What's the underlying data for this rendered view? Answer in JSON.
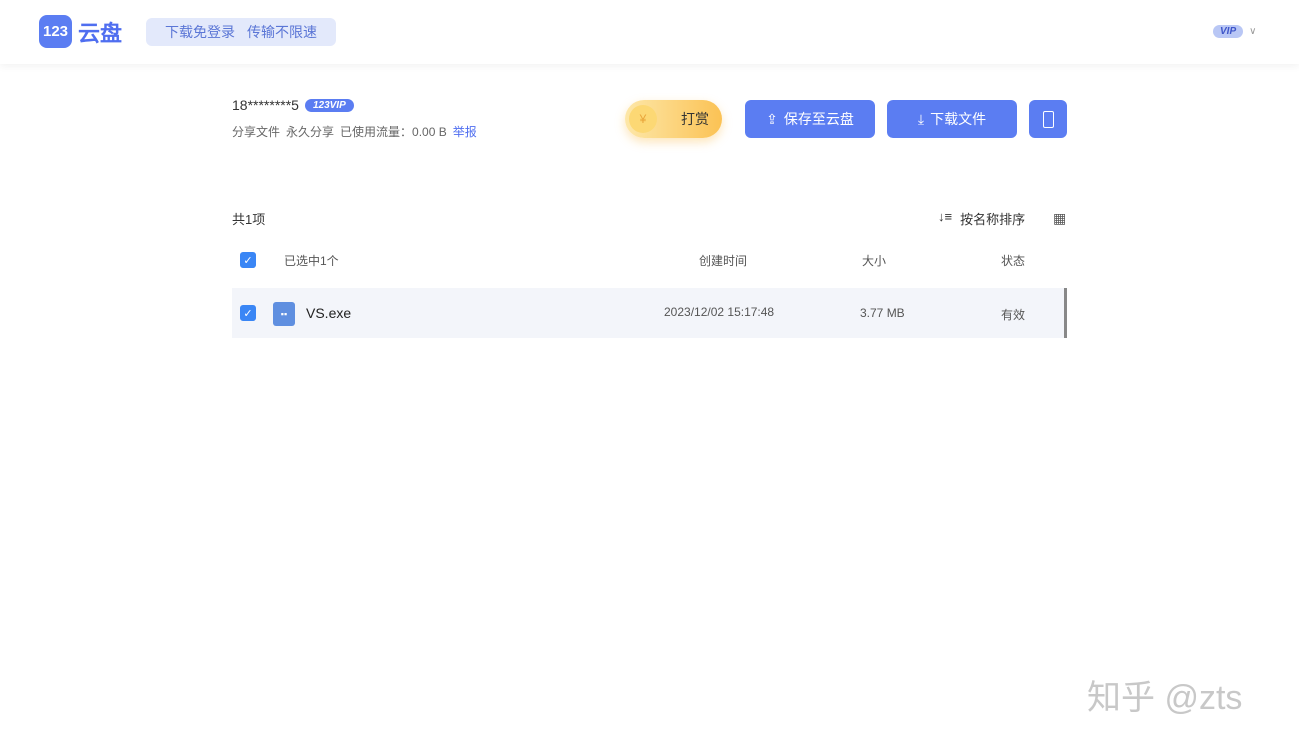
{
  "header": {
    "logo_mark": "123",
    "logo_text": "云盘",
    "slogan": [
      "下载免登录",
      "传输不限速"
    ],
    "vip": "VIP"
  },
  "share": {
    "user": "18********5",
    "user_badge": "123VIP",
    "meta": [
      "分享文件",
      "永久分享",
      "已使用流量：0.00 B"
    ],
    "report": "举报"
  },
  "actions": {
    "tip": "打赏",
    "save": "保存至云盘",
    "download": "下载文件"
  },
  "list": {
    "count": "共1项",
    "sort": "按名称排序",
    "columns": {
      "selected": "已选中1个",
      "created": "创建时间",
      "size": "大小",
      "status": "状态"
    },
    "rows": [
      {
        "name": "VS.exe",
        "created": "2023/12/02 15:17:48",
        "size": "3.77 MB",
        "status": "有效"
      }
    ]
  },
  "watermark": "知乎 @zts"
}
